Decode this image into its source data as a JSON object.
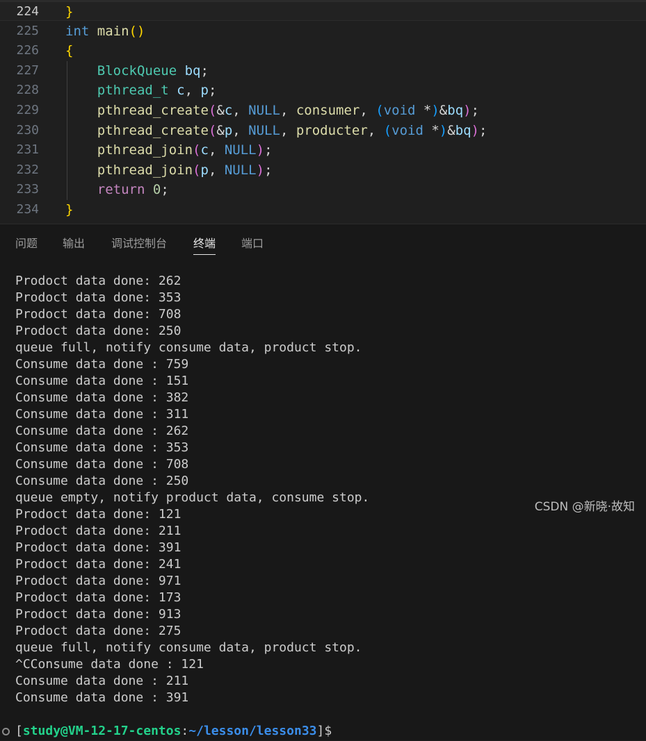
{
  "editor": {
    "lines": [
      {
        "num": "224",
        "active": true,
        "segments": [
          {
            "t": "}",
            "c": "t-b1"
          }
        ]
      },
      {
        "num": "225",
        "segments": [
          {
            "t": "int",
            "c": "t-kw"
          },
          {
            "t": " ",
            "c": "t-p"
          },
          {
            "t": "main",
            "c": "t-fn"
          },
          {
            "t": "()",
            "c": "t-b1"
          }
        ]
      },
      {
        "num": "226",
        "segments": [
          {
            "t": "{",
            "c": "t-b1"
          }
        ]
      },
      {
        "num": "227",
        "segments": [
          {
            "t": "    ",
            "c": "t-p"
          },
          {
            "t": "BlockQueue",
            "c": "t-type"
          },
          {
            "t": " ",
            "c": "t-p"
          },
          {
            "t": "bq",
            "c": "t-var"
          },
          {
            "t": ";",
            "c": "t-p"
          }
        ]
      },
      {
        "num": "228",
        "segments": [
          {
            "t": "    ",
            "c": "t-p"
          },
          {
            "t": "pthread_t",
            "c": "t-type"
          },
          {
            "t": " ",
            "c": "t-p"
          },
          {
            "t": "c",
            "c": "t-var"
          },
          {
            "t": ", ",
            "c": "t-p"
          },
          {
            "t": "p",
            "c": "t-var"
          },
          {
            "t": ";",
            "c": "t-p"
          }
        ]
      },
      {
        "num": "229",
        "segments": [
          {
            "t": "    ",
            "c": "t-p"
          },
          {
            "t": "pthread_create",
            "c": "t-fn"
          },
          {
            "t": "(",
            "c": "t-b2"
          },
          {
            "t": "&",
            "c": "t-p"
          },
          {
            "t": "c",
            "c": "t-var"
          },
          {
            "t": ", ",
            "c": "t-p"
          },
          {
            "t": "NULL",
            "c": "t-kw"
          },
          {
            "t": ", ",
            "c": "t-p"
          },
          {
            "t": "consumer",
            "c": "t-fn"
          },
          {
            "t": ", ",
            "c": "t-p"
          },
          {
            "t": "(",
            "c": "t-b3"
          },
          {
            "t": "void",
            "c": "t-kw"
          },
          {
            "t": " *",
            "c": "t-p"
          },
          {
            "t": ")",
            "c": "t-b3"
          },
          {
            "t": "&",
            "c": "t-p"
          },
          {
            "t": "bq",
            "c": "t-var"
          },
          {
            "t": ")",
            "c": "t-b2"
          },
          {
            "t": ";",
            "c": "t-p"
          }
        ]
      },
      {
        "num": "230",
        "segments": [
          {
            "t": "    ",
            "c": "t-p"
          },
          {
            "t": "pthread_create",
            "c": "t-fn"
          },
          {
            "t": "(",
            "c": "t-b2"
          },
          {
            "t": "&",
            "c": "t-p"
          },
          {
            "t": "p",
            "c": "t-var"
          },
          {
            "t": ", ",
            "c": "t-p"
          },
          {
            "t": "NULL",
            "c": "t-kw"
          },
          {
            "t": ", ",
            "c": "t-p"
          },
          {
            "t": "producter",
            "c": "t-fn"
          },
          {
            "t": ", ",
            "c": "t-p"
          },
          {
            "t": "(",
            "c": "t-b3"
          },
          {
            "t": "void",
            "c": "t-kw"
          },
          {
            "t": " *",
            "c": "t-p"
          },
          {
            "t": ")",
            "c": "t-b3"
          },
          {
            "t": "&",
            "c": "t-p"
          },
          {
            "t": "bq",
            "c": "t-var"
          },
          {
            "t": ")",
            "c": "t-b2"
          },
          {
            "t": ";",
            "c": "t-p"
          }
        ]
      },
      {
        "num": "231",
        "segments": [
          {
            "t": "    ",
            "c": "t-p"
          },
          {
            "t": "pthread_join",
            "c": "t-fn"
          },
          {
            "t": "(",
            "c": "t-b2"
          },
          {
            "t": "c",
            "c": "t-var"
          },
          {
            "t": ", ",
            "c": "t-p"
          },
          {
            "t": "NULL",
            "c": "t-kw"
          },
          {
            "t": ")",
            "c": "t-b2"
          },
          {
            "t": ";",
            "c": "t-p"
          }
        ]
      },
      {
        "num": "232",
        "segments": [
          {
            "t": "    ",
            "c": "t-p"
          },
          {
            "t": "pthread_join",
            "c": "t-fn"
          },
          {
            "t": "(",
            "c": "t-b2"
          },
          {
            "t": "p",
            "c": "t-var"
          },
          {
            "t": ", ",
            "c": "t-p"
          },
          {
            "t": "NULL",
            "c": "t-kw"
          },
          {
            "t": ")",
            "c": "t-b2"
          },
          {
            "t": ";",
            "c": "t-p"
          }
        ]
      },
      {
        "num": "233",
        "segments": [
          {
            "t": "    ",
            "c": "t-p"
          },
          {
            "t": "return",
            "c": "t-kwc"
          },
          {
            "t": " ",
            "c": "t-p"
          },
          {
            "t": "0",
            "c": "t-num"
          },
          {
            "t": ";",
            "c": "t-p"
          }
        ]
      },
      {
        "num": "234",
        "segments": [
          {
            "t": "}",
            "c": "t-b1"
          }
        ]
      }
    ]
  },
  "panel": {
    "tabs": [
      {
        "label": "问题",
        "name": "tab-problems"
      },
      {
        "label": "输出",
        "name": "tab-output"
      },
      {
        "label": "调试控制台",
        "name": "tab-debug-console"
      },
      {
        "label": "终端",
        "name": "tab-terminal",
        "active": true
      },
      {
        "label": "端口",
        "name": "tab-ports"
      }
    ],
    "terminal_lines": [
      "Prodoct data done: 262",
      "Prodoct data done: 353",
      "Prodoct data done: 708",
      "Prodoct data done: 250",
      "queue full, notify consume data, product stop.",
      "Consume data done : 759",
      "Consume data done : 151",
      "Consume data done : 382",
      "Consume data done : 311",
      "Consume data done : 262",
      "Consume data done : 353",
      "Consume data done : 708",
      "Consume data done : 250",
      "queue empty, notify product data, consume stop.",
      "Prodoct data done: 121",
      "Prodoct data done: 211",
      "Prodoct data done: 391",
      "Prodoct data done: 241",
      "Prodoct data done: 971",
      "Prodoct data done: 173",
      "Prodoct data done: 913",
      "Prodoct data done: 275",
      "queue full, notify consume data, product stop.",
      "^CConsume data done : 121",
      "Consume data done : 211",
      "Consume data done : 391"
    ],
    "prompt": {
      "open": "[",
      "user_host": "study@VM-12-17-centos",
      "colon": ":",
      "path": "~/lesson/lesson33",
      "close": "]$"
    }
  },
  "watermark": "CSDN @新晓·故知"
}
